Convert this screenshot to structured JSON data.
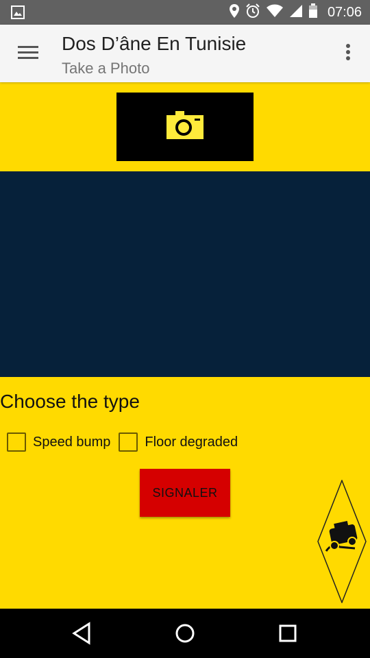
{
  "status_bar": {
    "time": "07:06",
    "icons": [
      "image-icon",
      "location-icon",
      "alarm-icon",
      "wifi-icon",
      "signal-icon",
      "battery-icon"
    ]
  },
  "app_bar": {
    "title": "Dos D’âne En Tunisie",
    "subtitle": "Take a Photo",
    "menu_icon": "hamburger-icon",
    "overflow_icon": "overflow-menu-icon"
  },
  "camera_button": {
    "icon": "camera-icon",
    "icon_color": "#FFEB3B"
  },
  "main": {
    "section_title": "Choose the type",
    "options": [
      {
        "label": "Speed bump",
        "checked": false
      },
      {
        "label": "Floor degraded",
        "checked": false
      }
    ],
    "submit_label": "SIGNALER"
  },
  "sign_icon": "bump-warning-sign-icon",
  "nav_bar": {
    "icons": [
      "back-icon",
      "home-icon",
      "recents-icon"
    ]
  },
  "colors": {
    "background": "#FFDA00",
    "preview": "#06213A",
    "button": "#D50000",
    "status_bar": "#616161",
    "app_bar": "#F5F5F5"
  }
}
